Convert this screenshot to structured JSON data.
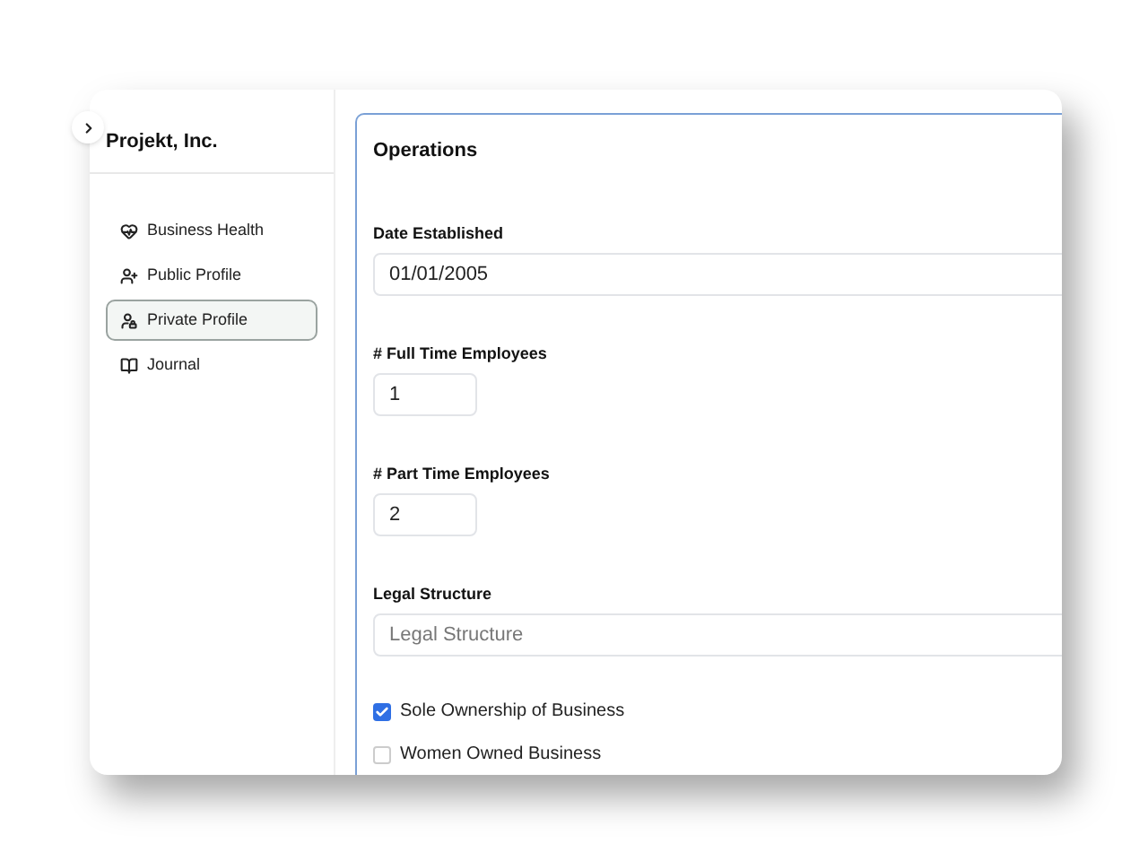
{
  "sidebar": {
    "title": "Projekt, Inc.",
    "items": [
      {
        "label": "Business Health",
        "selected": false
      },
      {
        "label": "Public Profile",
        "selected": false
      },
      {
        "label": "Private Profile",
        "selected": true
      },
      {
        "label": "Journal",
        "selected": false
      }
    ]
  },
  "section": {
    "title": "Operations",
    "fields": [
      {
        "kind": "wide",
        "label": "Date Established",
        "value": "01/01/2005"
      },
      {
        "kind": "narrow",
        "label": "# Full Time Employees",
        "value": "1"
      },
      {
        "kind": "narrow",
        "label": "# Part Time Employees",
        "value": "2"
      },
      {
        "kind": "select",
        "label": "Legal Structure",
        "placeholder": "Legal Structure"
      },
      {
        "kind": "checkbox",
        "label": "Sole Ownership of Business",
        "checked": true
      },
      {
        "kind": "checkbox",
        "label": "Women Owned Business",
        "checked": false
      }
    ]
  }
}
